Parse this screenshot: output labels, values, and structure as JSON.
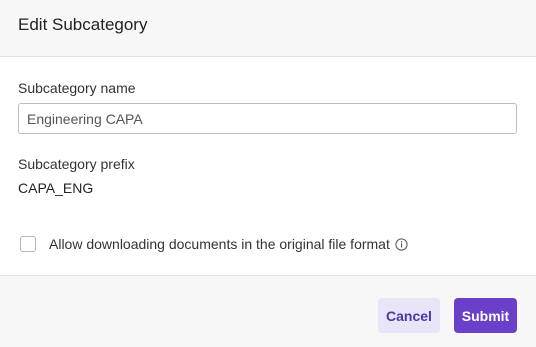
{
  "dialog": {
    "title": "Edit Subcategory"
  },
  "name_field": {
    "label": "Subcategory name",
    "value": "Engineering CAPA"
  },
  "prefix_field": {
    "label": "Subcategory prefix",
    "value": "CAPA_ENG"
  },
  "download_option": {
    "label": "Allow downloading documents in the original file format",
    "checked": false,
    "info_icon": "info-circle-icon"
  },
  "footer": {
    "cancel_label": "Cancel",
    "submit_label": "Submit"
  },
  "colors": {
    "primary": "#6a3fc9",
    "secondary_bg": "#e9e5f8",
    "secondary_text": "#4d37a6"
  }
}
